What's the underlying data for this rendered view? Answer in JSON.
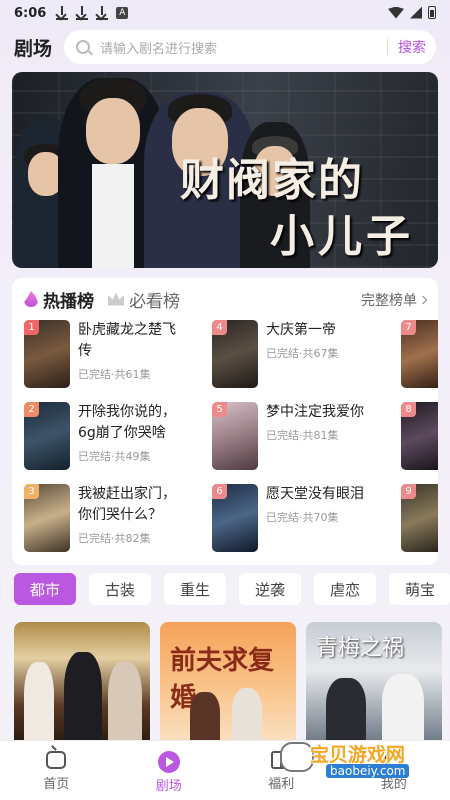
{
  "status": {
    "time": "6:06",
    "icons": [
      "download-icon",
      "download-icon",
      "download-icon",
      "a-icon",
      "wifi-icon",
      "cell-icon",
      "battery-icon"
    ]
  },
  "header": {
    "title": "剧场",
    "search_placeholder": "请输入剧名进行搜索",
    "search_button": "搜索"
  },
  "banner": {
    "title_line1": "财阀家的",
    "title_line2": "小儿子"
  },
  "ranking": {
    "tabs": [
      "热播榜",
      "必看榜"
    ],
    "full_list": "完整榜单",
    "items": [
      {
        "rank": "1",
        "name": "卧虎藏龙之楚飞传",
        "meta": "已完结·共61集"
      },
      {
        "rank": "2",
        "name": "开除我你说的，6g崩了你哭啥",
        "meta": "已完结·共49集"
      },
      {
        "rank": "3",
        "name": "我被赶出家门，你们哭什么？",
        "meta": "已完结·共82集"
      },
      {
        "rank": "4",
        "name": "大庆第一帝",
        "meta": "已完结·共67集"
      },
      {
        "rank": "5",
        "name": "梦中注定我爱你",
        "meta": "已完结·共81集"
      },
      {
        "rank": "6",
        "name": "愿天堂没有眼泪",
        "meta": "已完结·共70集"
      },
      {
        "rank": "7",
        "name": "",
        "meta": ""
      },
      {
        "rank": "8",
        "name": "",
        "meta": ""
      },
      {
        "rank": "9",
        "name": "",
        "meta": ""
      }
    ]
  },
  "genres": [
    "都市",
    "古装",
    "重生",
    "逆袭",
    "虐恋",
    "萌宝"
  ],
  "thumbs": [
    {
      "title": ""
    },
    {
      "title": "前夫求复婚"
    },
    {
      "title": "青梅之祸"
    }
  ],
  "tabbar": [
    "首页",
    "剧场",
    "福利",
    "我的"
  ],
  "watermark": {
    "text": "宝贝游戏网",
    "url": "baobeiy.com"
  },
  "colors": {
    "accent": "#bb58e2",
    "background": "#f2eef8"
  }
}
